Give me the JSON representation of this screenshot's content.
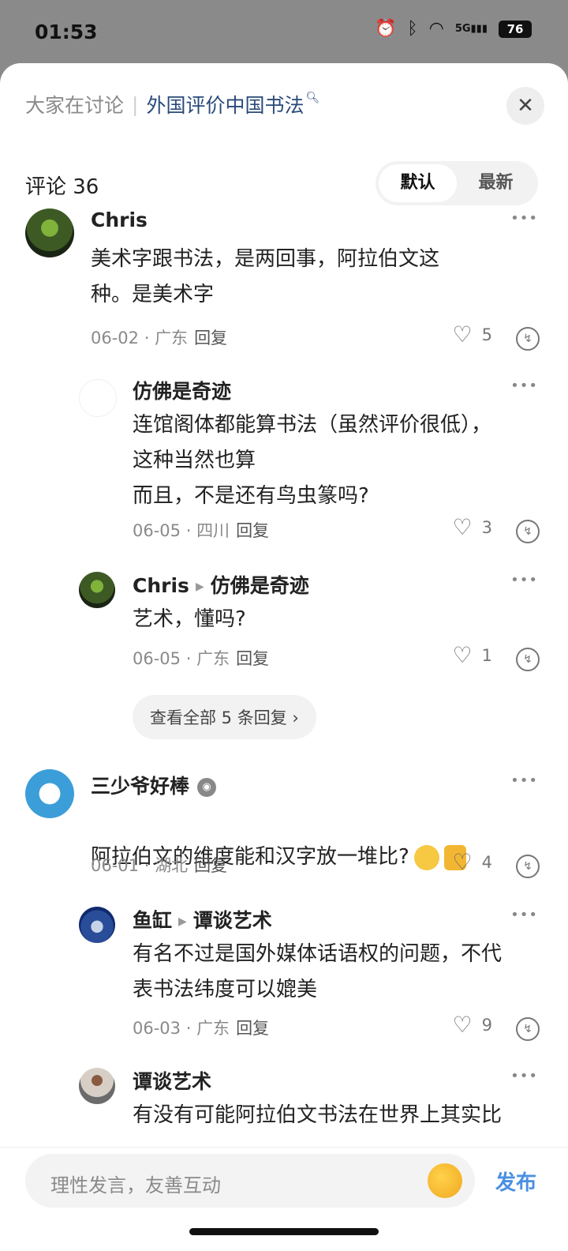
{
  "status_bar": {
    "time": "01:53",
    "icons": [
      "alarm-icon",
      "bluetooth-icon",
      "wifi-icon",
      "5g-signal-icon"
    ],
    "network": "5G",
    "battery": "76"
  },
  "header": {
    "topic_label": "大家在讨论",
    "topic_link": "外国评价中国书法",
    "close_icon": "close-icon"
  },
  "comments_header": {
    "label": "评论 36",
    "sort": {
      "default": "默认",
      "latest": "最新",
      "active": "默认"
    }
  },
  "comments": [
    {
      "user": "Chris",
      "text": "美术字跟书法，是两回事，阿拉伯文这\n种。是美术字",
      "date": "06-02",
      "location": "广东",
      "reply": "回复",
      "likes": "5"
    },
    {
      "user": "仿佛是奇迹",
      "text": "连馆阁体都能算书法（虽然评价很低），\n这种当然也算\n而且，不是还有鸟虫篆吗?",
      "date": "06-05",
      "location": "四川",
      "reply": "回复",
      "likes": "3"
    },
    {
      "user": "Chris",
      "reply_to": "仿佛是奇迹",
      "text": "艺术，懂吗?",
      "date": "06-05",
      "location": "广东",
      "reply": "回复",
      "likes": "1"
    },
    {
      "view_all": "查看全部 5 条回复 ›"
    },
    {
      "user": "三少爷好棒",
      "text": "阿拉伯文的维度能和汉字放一堆比?",
      "date": "06-01",
      "location": "湖北",
      "reply": "回复",
      "likes": "4"
    },
    {
      "user": "鱼缸",
      "reply_to": "谭谈艺术",
      "text": "有名不过是国外媒体话语权的问题，不代\n表书法纬度可以媲美",
      "date": "06-03",
      "location": "广东",
      "reply": "回复",
      "likes": "9"
    },
    {
      "user": "谭谈艺术",
      "text": "有没有可能阿拉伯文书法在世界上其实比"
    }
  ],
  "bottom_bar": {
    "placeholder": "理性发言，友善互动",
    "send": "发布"
  }
}
